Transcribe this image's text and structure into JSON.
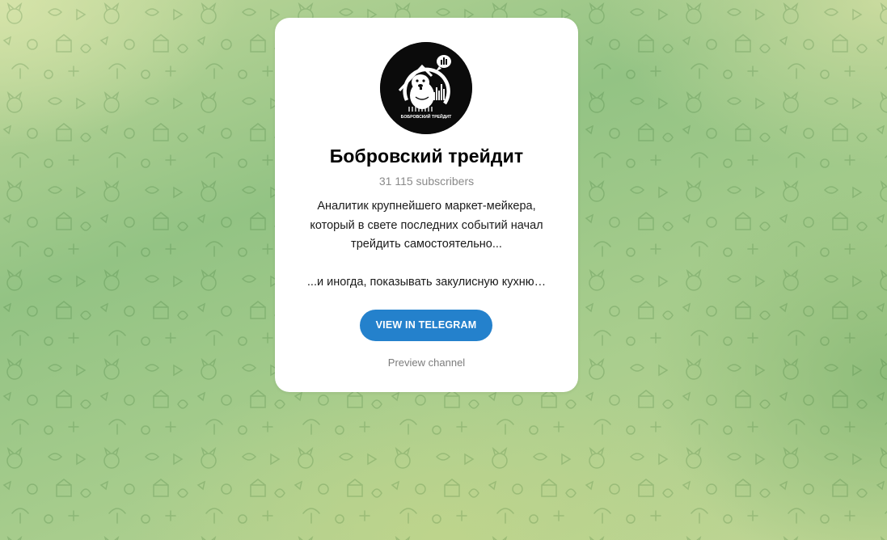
{
  "channel": {
    "name": "Бобровский трейдит",
    "subscribers": "31 115 subscribers",
    "description_lines": [
      "Аналитик крупнейшего маркет-мейкера,",
      "который в свете последних событий начал",
      "трейдить самостоятельно...",
      "",
      "...и иногда, показывать закулисную кухню…"
    ],
    "avatar_text": "БОБРОВСКИЙ ТРЕЙДИТ"
  },
  "actions": {
    "view_label": "VIEW IN TELEGRAM",
    "preview_label": "Preview channel"
  },
  "colors": {
    "accent": "#2481cc",
    "card_background": "#ffffff",
    "background_green": "#93c384"
  },
  "icons": {
    "avatar": "beaver-trader-logo",
    "background": "doodle-pattern"
  }
}
